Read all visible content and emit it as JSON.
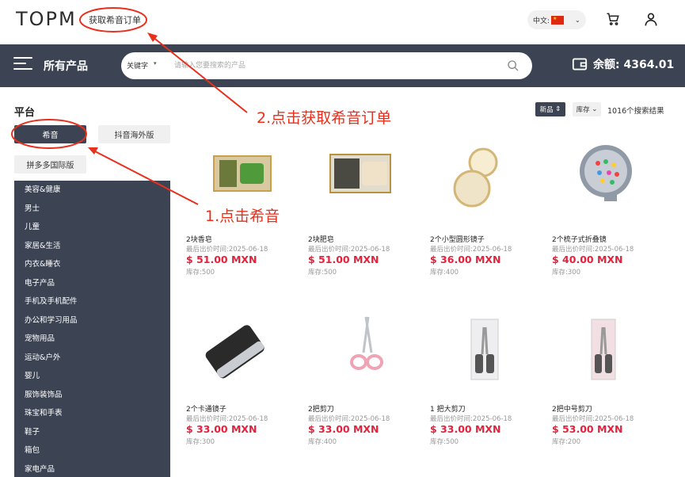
{
  "header": {
    "logo": "TOPM",
    "get_orders": "获取希音订单",
    "language": "中文:",
    "cart_icon": "cart-icon",
    "user_icon": "user-icon"
  },
  "navbar": {
    "all_products": "所有产品",
    "search_mode": "关键字",
    "search_placeholder": "请输入您要搜索的产品",
    "balance": "余额: 4364.01"
  },
  "sidebar": {
    "platform_title": "平台",
    "platforms": [
      "希音",
      "抖音海外版",
      "拼多多国际版"
    ],
    "categories": [
      "美容&健康",
      "男士",
      "儿童",
      "家居&生活",
      "内衣&睡衣",
      "电子产品",
      "手机及手机配件",
      "办公和学习用品",
      "宠物用品",
      "运动&户外",
      "婴儿",
      "服饰装饰品",
      "珠宝和手表",
      "鞋子",
      "箱包",
      "家电产品"
    ]
  },
  "toolbar": {
    "sort_new": "新品",
    "sort_stock": "库存",
    "result_count": "1016个搜索结果"
  },
  "products": [
    {
      "name": "2块香皂",
      "date": "最后出价时间:2025-06-18",
      "price": "$ 51.00 MXN",
      "stock": "库存:500"
    },
    {
      "name": "2块肥皂",
      "date": "最后出价时间:2025-06-18",
      "price": "$ 51.00 MXN",
      "stock": "库存:500"
    },
    {
      "name": "2个小型圆形镜子",
      "date": "最后出价时间:2025-06-18",
      "price": "$ 36.00 MXN",
      "stock": "库存:400"
    },
    {
      "name": "2个梳子式折叠镜",
      "date": "最后出价时间:2025-06-18",
      "price": "$ 40.00 MXN",
      "stock": "库存:300"
    },
    {
      "name": "2个卡通镜子",
      "date": "最后出价时间:2025-06-18",
      "price": "$ 33.00 MXN",
      "stock": "库存:300"
    },
    {
      "name": "2把剪刀",
      "date": "最后出价时间:2025-06-18",
      "price": "$ 33.00 MXN",
      "stock": "库存:400"
    },
    {
      "name": "1 把大剪刀",
      "date": "最后出价时间:2025-06-18",
      "price": "$ 33.00 MXN",
      "stock": "库存:500"
    },
    {
      "name": "2把中号剪刀",
      "date": "最后出价时间:2025-06-18",
      "price": "$ 53.00 MXN",
      "stock": "库存:200"
    }
  ],
  "annotations": {
    "step1": "1.点击希音",
    "step2": "2.点击获取希音订单"
  },
  "colors": {
    "nav_bg": "#3c4454",
    "price": "#e6213c",
    "annotation": "#e8301c"
  }
}
